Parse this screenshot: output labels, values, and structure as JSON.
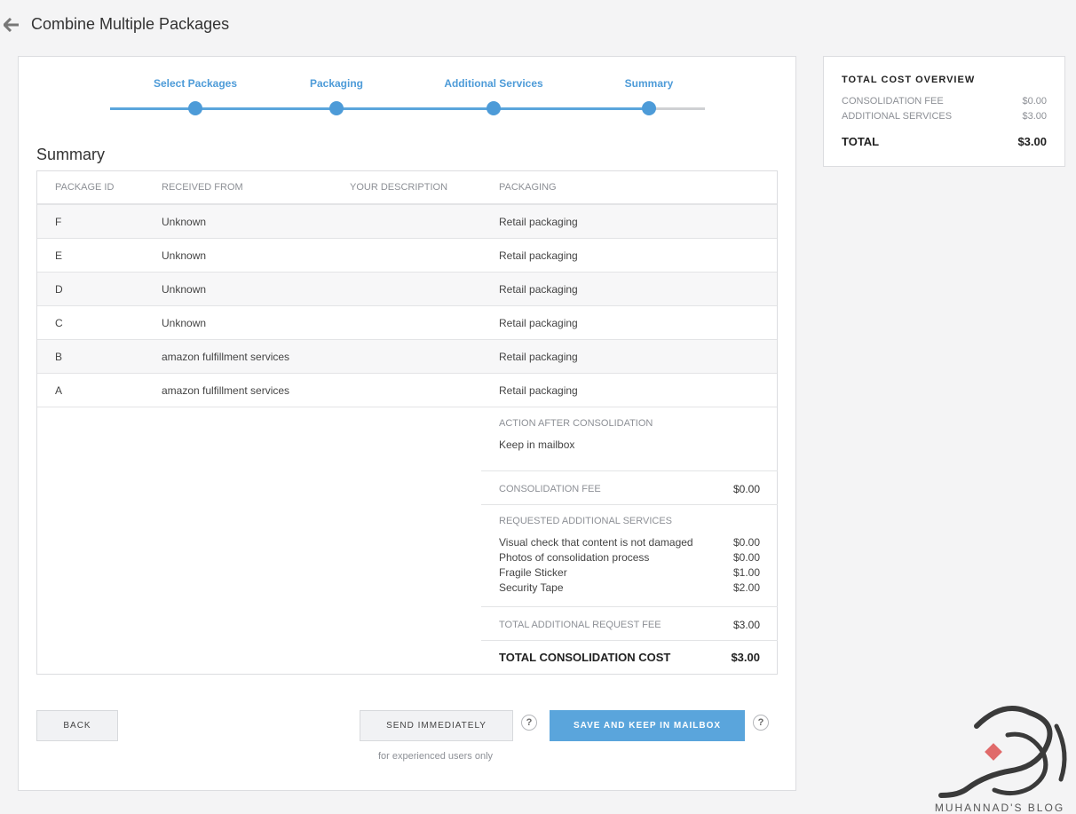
{
  "header": {
    "title": "Combine Multiple Packages"
  },
  "stepper": {
    "steps": [
      {
        "label": "Select Packages"
      },
      {
        "label": "Packaging"
      },
      {
        "label": "Additional Services"
      },
      {
        "label": "Summary"
      }
    ]
  },
  "summary": {
    "title": "Summary",
    "columns": [
      "PACKAGE ID",
      "RECEIVED FROM",
      "YOUR DESCRIPTION",
      "PACKAGING"
    ],
    "rows": [
      {
        "id": "F",
        "from": "Unknown",
        "description": "",
        "packaging": "Retail packaging"
      },
      {
        "id": "E",
        "from": "Unknown",
        "description": "",
        "packaging": "Retail packaging"
      },
      {
        "id": "D",
        "from": "Unknown",
        "description": "",
        "packaging": "Retail packaging"
      },
      {
        "id": "C",
        "from": "Unknown",
        "description": "",
        "packaging": "Retail packaging"
      },
      {
        "id": "B",
        "from": "amazon fulfillment services",
        "description": "",
        "packaging": "Retail packaging"
      },
      {
        "id": "A",
        "from": "amazon fulfillment services",
        "description": "",
        "packaging": "Retail packaging"
      }
    ],
    "action_heading": "ACTION AFTER CONSOLIDATION",
    "action_value": "Keep in mailbox",
    "consolidation_fee_label": "CONSOLIDATION FEE",
    "consolidation_fee_value": "$0.00",
    "services_heading": "REQUESTED ADDITIONAL SERVICES",
    "services": [
      {
        "label": "Visual check that content is not damaged",
        "price": "$0.00"
      },
      {
        "label": "Photos of consolidation process",
        "price": "$0.00"
      },
      {
        "label": "Fragile Sticker",
        "price": "$1.00"
      },
      {
        "label": "Security Tape",
        "price": "$2.00"
      }
    ],
    "total_additional_label": "TOTAL ADDITIONAL REQUEST FEE",
    "total_additional_value": "$3.00",
    "total_cost_label": "TOTAL CONSOLIDATION COST",
    "total_cost_value": "$3.00"
  },
  "actions": {
    "back_label": "BACK",
    "send_label": "SEND IMMEDIATELY",
    "save_label": "SAVE AND KEEP IN MAILBOX",
    "help_symbol": "?",
    "hint": "for experienced users only"
  },
  "overview": {
    "title": "TOTAL COST OVERVIEW",
    "consolidation_fee_label": "CONSOLIDATION FEE",
    "consolidation_fee_value": "$0.00",
    "additional_services_label": "ADDITIONAL SERVICES",
    "additional_services_value": "$3.00",
    "total_label": "TOTAL",
    "total_value": "$3.00"
  },
  "watermark": {
    "text": "MUHANNAD'S BLOG"
  },
  "colors": {
    "accent": "#5aa5dc",
    "step_label": "#4d9bd8",
    "background": "#f4f4f5"
  }
}
